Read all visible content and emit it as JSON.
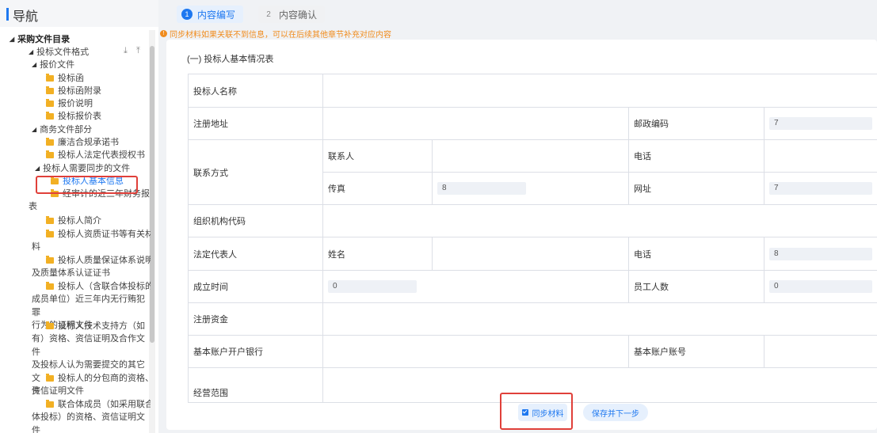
{
  "nav": {
    "title": "导航"
  },
  "tree": {
    "root": "采购文件目录",
    "fmt": "投标文件格式",
    "price": "报价文件",
    "price_items": [
      "投标函",
      "投标函附录",
      "报价说明",
      "投标报价表"
    ],
    "biz": "商务文件部分",
    "biz_items": [
      "廉洁合规承诺书",
      "投标人法定代表授权书"
    ],
    "sync": "投标人需要同步的文件",
    "sync_items": [
      "投标人基本信息"
    ],
    "wrap_items": [
      {
        "first": "经审计的近三年财务报",
        "rest": "表"
      },
      {
        "first": "投标人简介",
        "rest": ""
      },
      {
        "first": "投标人资质证书等有关材",
        "rest": "料"
      },
      {
        "first": "投标人质量保证体系说明",
        "rest": "及质量体系认证证书"
      },
      {
        "first": "投标人（含联合体投标的",
        "rest": "成员单位）近三年内无行贿犯罪\n行为的证明文件"
      },
      {
        "first": "投标人技术支持方（如",
        "rest": "有）资格、资信证明及合作文件\n及投标人认为需要提交的其它文\n件"
      },
      {
        "first": "投标人的分包商的资格、",
        "rest": "资信证明文件"
      },
      {
        "first": "联合体成员（如采用联合",
        "rest": "体投标）的资格、资信证明文\n件"
      }
    ]
  },
  "steps": {
    "s1_num": "1",
    "s1": "内容编写",
    "s2_num": "2",
    "s2": "内容确认"
  },
  "notice": "同步材料如果关联不到信息，可以在后续其他章节补充对应内容",
  "section_title": "(一)  投标人基本情况表",
  "form": {
    "bidder_name": "投标人名称",
    "reg_addr": "注册地址",
    "postcode": "邮政编码",
    "postcode_val": "7",
    "contact": "联系方式",
    "contact_person": "联系人",
    "phone": "电话",
    "fax": "传真",
    "fax_val": "8",
    "website": "网址",
    "website_val": "7",
    "org_code": "组织机构代码",
    "legal_rep": "法定代表人",
    "name": "姓名",
    "rep_phone": "电话",
    "rep_phone_val": "8",
    "founded": "成立时间",
    "founded_val": "0",
    "staff": "员工人数",
    "staff_val": "0",
    "reg_capital": "注册资金",
    "bank": "基本账户开户银行",
    "account": "基本账户账号",
    "scope": "经营范围"
  },
  "buttons": {
    "sync": "同步材料",
    "save": "保存并下一步"
  },
  "colors": {
    "accent": "#1e78f0",
    "highlight": "#e0403a",
    "warning": "#f08c1e"
  }
}
